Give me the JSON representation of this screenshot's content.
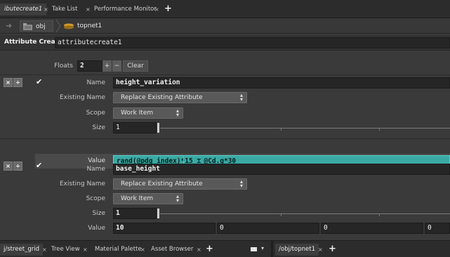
{
  "top_tabs": [
    {
      "label": "ibutecreate1",
      "close": "×",
      "active": true
    },
    {
      "label": "Take List",
      "close": "×",
      "active": false
    },
    {
      "label": "Performance Monitor",
      "close": "×",
      "active": false
    }
  ],
  "add_tab": "+",
  "path": {
    "back_icon": "arrow-right-icon",
    "items": [
      {
        "label": "obj",
        "icon": "folder-icon"
      },
      {
        "label": "topnet1",
        "icon": "topnet-icon"
      }
    ]
  },
  "node": {
    "type": "Attribute Create",
    "name": "attributecreate1"
  },
  "floats": {
    "label": "Floats",
    "count": "2",
    "plus": "+",
    "minus": "−",
    "clear": "Clear"
  },
  "attributes": [
    {
      "name_label": "Name",
      "name": "height_variation",
      "existing_label": "Existing Name",
      "existing": "Replace Existing Attribute",
      "scope_label": "Scope",
      "scope": "Work Item",
      "size_label": "Size",
      "size": "1",
      "value_label": "Value",
      "values": [
        "rand(@pdg_index)*15 ",
        "@Cd.g*30"
      ]
    },
    {
      "name_label": "Name",
      "name": "base_height",
      "existing_label": "Existing Name",
      "existing": "Replace Existing Attribute",
      "scope_label": "Scope",
      "scope": "Work Item",
      "size_label": "Size",
      "size": "1",
      "value_label": "Value",
      "values": [
        "10",
        "0",
        "0",
        "0"
      ]
    }
  ],
  "mini_buttons": {
    "remove": "×",
    "move": "÷"
  },
  "checkbox": "✔",
  "bottom_tabs_left": [
    {
      "label": "j/street_grid",
      "close": "×",
      "active": true
    },
    {
      "label": "Tree View",
      "close": "×",
      "active": false
    },
    {
      "label": "Material Palette",
      "close": "×",
      "active": false
    },
    {
      "label": "Asset Browser",
      "close": "×",
      "active": false
    }
  ],
  "bottom_tabs_right": [
    {
      "label": "/obj/topnet1",
      "close": "×",
      "active": true
    }
  ],
  "colors": {
    "accent": "#3aa9a4",
    "cursor": "#e0b000"
  }
}
